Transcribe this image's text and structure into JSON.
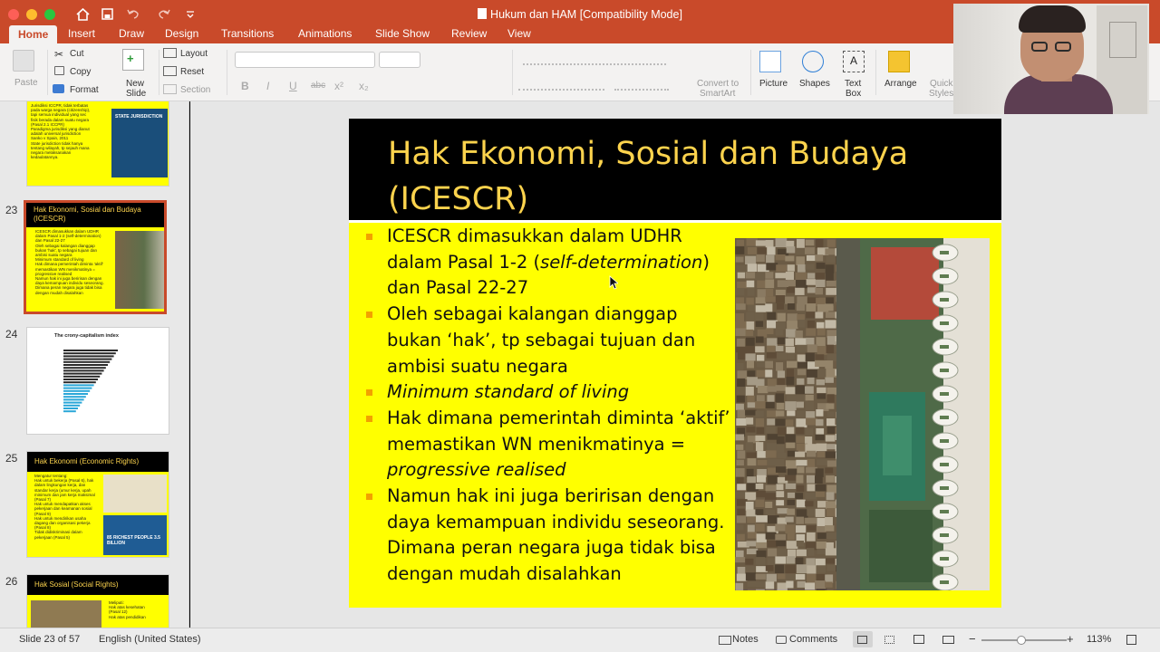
{
  "window": {
    "title": "Hukum dan HAM [Compatibility Mode]"
  },
  "quick_access": [
    "home-icon",
    "save-icon",
    "undo-icon",
    "redo-icon",
    "customize-icon"
  ],
  "ribbon_tabs": [
    "Home",
    "Insert",
    "Draw",
    "Design",
    "Transitions",
    "Animations",
    "Slide Show",
    "Review",
    "View"
  ],
  "ribbon": {
    "paste": "Paste",
    "cut": "Cut",
    "copy": "Copy",
    "format": "Format",
    "new_slide_1": "New",
    "new_slide_2": "Slide",
    "layout": "Layout",
    "reset": "Reset",
    "section": "Section",
    "convert_1": "Convert to",
    "convert_2": "SmartArt",
    "picture": "Picture",
    "shapes": "Shapes",
    "textbox_1": "Text",
    "textbox_2": "Box",
    "arrange": "Arrange",
    "quick_styles_1": "Quick",
    "quick_styles_2": "Styles"
  },
  "thumbnails": [
    {
      "number": "23",
      "title": "Hak Ekonomi, Sosial dan Budaya (ICESCR)"
    },
    {
      "number": "24",
      "title": "The crony-capitalism index"
    },
    {
      "number": "25",
      "title": "Hak Ekonomi (Economic Rights)"
    },
    {
      "number": "26",
      "title": "Hak Sosial (Social Rights)"
    }
  ],
  "thumb_top": {
    "lines": [
      "Jurisdiksi ICCPR, tidak terbatas",
      "pada warga negara (citizenship),",
      "tapi semua individual yang sec",
      "fisik berada dalam suatu negara",
      "(Pasal 2.1 ICCPR)",
      "Paradigma jurisdiksi yang dianut",
      "adalah universal jurisdiction",
      "Sanko v Spain, 2011",
      "State jurisdiction tidak hanya",
      "tentang wilayah, tp sejauh mana",
      "negara melaksanakan",
      "kedaulatannya."
    ],
    "badge": "STATE JURISDICTION"
  },
  "thumb23_lines": [
    "ICESCR dimasukkan dalam UDHR",
    "dalam Pasal 1-2 (self-determination)",
    "dan Pasal 22-27",
    "Oleh sebagai kalangan dianggap",
    "bukan 'hak', tp sebagai tujuan dan",
    "ambisi suatu negara",
    "Minimum standard of living",
    "Hak dimana pemerintah diminta 'aktif'",
    "memastikan WN menikmatinya =",
    "progressive realised",
    "Namun hak ini juga beririsan dengan",
    "daya kemampuan individu seseorang.",
    "Dimana peran negara juga tidak bisa",
    "dengan mudah disalahkan"
  ],
  "thumb25": {
    "lines": [
      "Mengatur tentang:",
      "Hak untuk bekerja (Pasal 6), hak",
      "dalam lingkungan kerja, dan",
      "standar kerja (umur kerja, upah",
      "minimum dan jam kerja maksimal",
      "(Pasal 7)",
      "Hak untuk mendapatkan akses",
      "pekerjaan dan keamanan sosial",
      "(Pasal 9)",
      "Hak untuk mendirikan usaha",
      "dagang dan organisasi pekerja",
      "(Pasal 8)",
      "Tidak didiskriminasi dalam",
      "pekerjaan (Pasal 5)"
    ],
    "badge": "85 RICHEST PEOPLE 3.5 BILLION"
  },
  "thumb26_lines": [
    "Meliputi:",
    "Hak atas kesehatan",
    "(Pasal 12)",
    "Hak atas pendidikan"
  ],
  "slide": {
    "title": "Hak Ekonomi, Sosial dan Budaya (ICESCR)",
    "bullets": [
      {
        "parts": [
          [
            "ICESCR dimasukkan dalam UDHR dalam Pasal 1-2 (",
            false
          ],
          [
            "self-determination",
            true
          ],
          [
            ") dan Pasal 22-27",
            false
          ]
        ]
      },
      {
        "parts": [
          [
            "Oleh sebagai kalangan dianggap bukan ‘hak’, tp sebagai tujuan dan ambisi suatu negara",
            false
          ]
        ]
      },
      {
        "parts": [
          [
            "Minimum  standard of living",
            true
          ]
        ]
      },
      {
        "parts": [
          [
            "Hak dimana pemerintah diminta ‘aktif’ memastikan WN menikmatinya = ",
            false
          ],
          [
            "progressive realised",
            true
          ]
        ]
      },
      {
        "parts": [
          [
            "Namun hak ini juga beririsan dengan daya kemampuan individu seseorang. Dimana peran negara juga tidak bisa dengan mudah disalahkan",
            false
          ]
        ]
      }
    ]
  },
  "status": {
    "slide_info": "Slide 23 of 57",
    "language": "English (United States)",
    "notes": "Notes",
    "comments": "Comments",
    "zoom": "113%"
  },
  "colors": {
    "accent": "#c94a2a",
    "slide_bg": "#ffff00",
    "title_text": "#fcd34d",
    "bullet": "#f2a100"
  }
}
